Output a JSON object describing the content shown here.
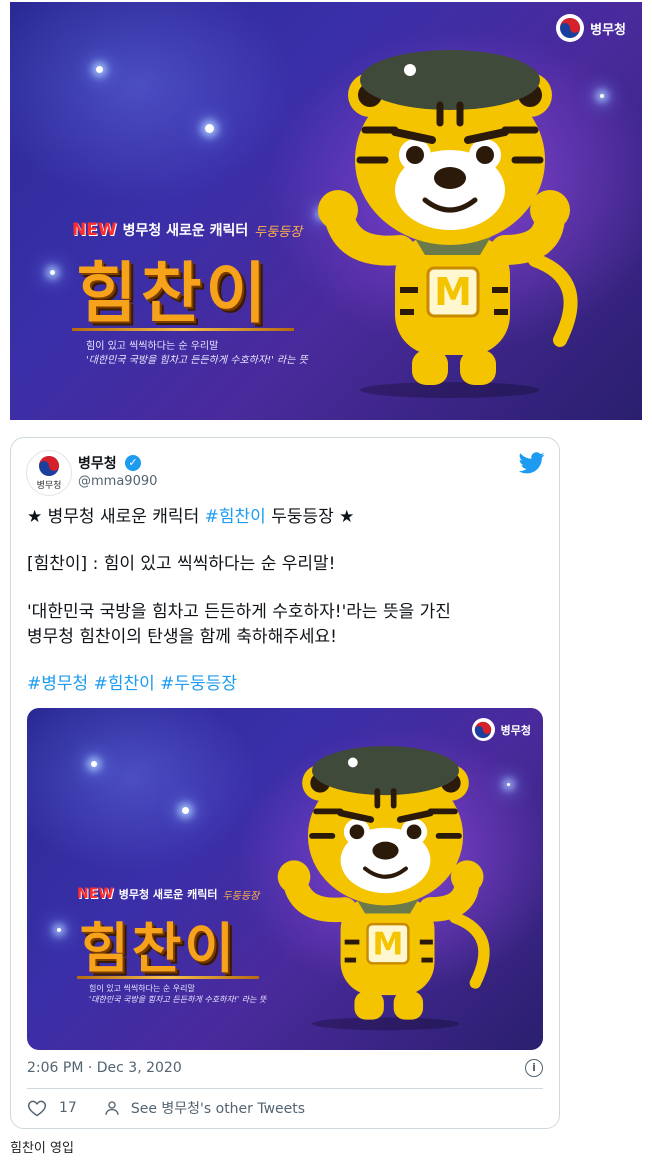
{
  "poster": {
    "brand": "병무청",
    "new_tag": "NEW",
    "subhead": "병무청 새로운 캐릭터",
    "handwritten": "두둥등장",
    "title": "힘찬이",
    "desc_line1": "힘이 있고 씩씩하다는 순 우리말",
    "desc_line2": "'대한민국 국방을 힘차고 든든하게 수호하자!' 라는 뜻",
    "badge_letter": "M"
  },
  "tweet": {
    "avatar_label": "병무청",
    "author": "병무청",
    "handle": "@mma9090",
    "line1_pre": "★ 병무청 새로운 캐릭터 ",
    "line1_tag": "#힘찬이",
    "line1_post": " 두둥등장 ★",
    "line2": "[힘찬이] : 힘이 있고 씩씩하다는 순 우리말!",
    "line3": "'대한민국 국방을 힘차고 든든하게 수호하자!'라는 뜻을 가진",
    "line4": "병무청 힘찬이의 탄생을 함께 축하해주세요!",
    "hashtags": [
      "#병무청",
      "#힘찬이",
      "#두둥등장"
    ],
    "timestamp": "2:06 PM · Dec 3, 2020",
    "info": "i",
    "like_count": "17",
    "see_other": "See 병무청's other Tweets"
  },
  "caption": "힘찬이 영입",
  "colors": {
    "accent": "#1d9bf0",
    "poster_bg": "#3a2fa8",
    "title_gold": "#f7a21b",
    "tiger": "#f5c400"
  }
}
